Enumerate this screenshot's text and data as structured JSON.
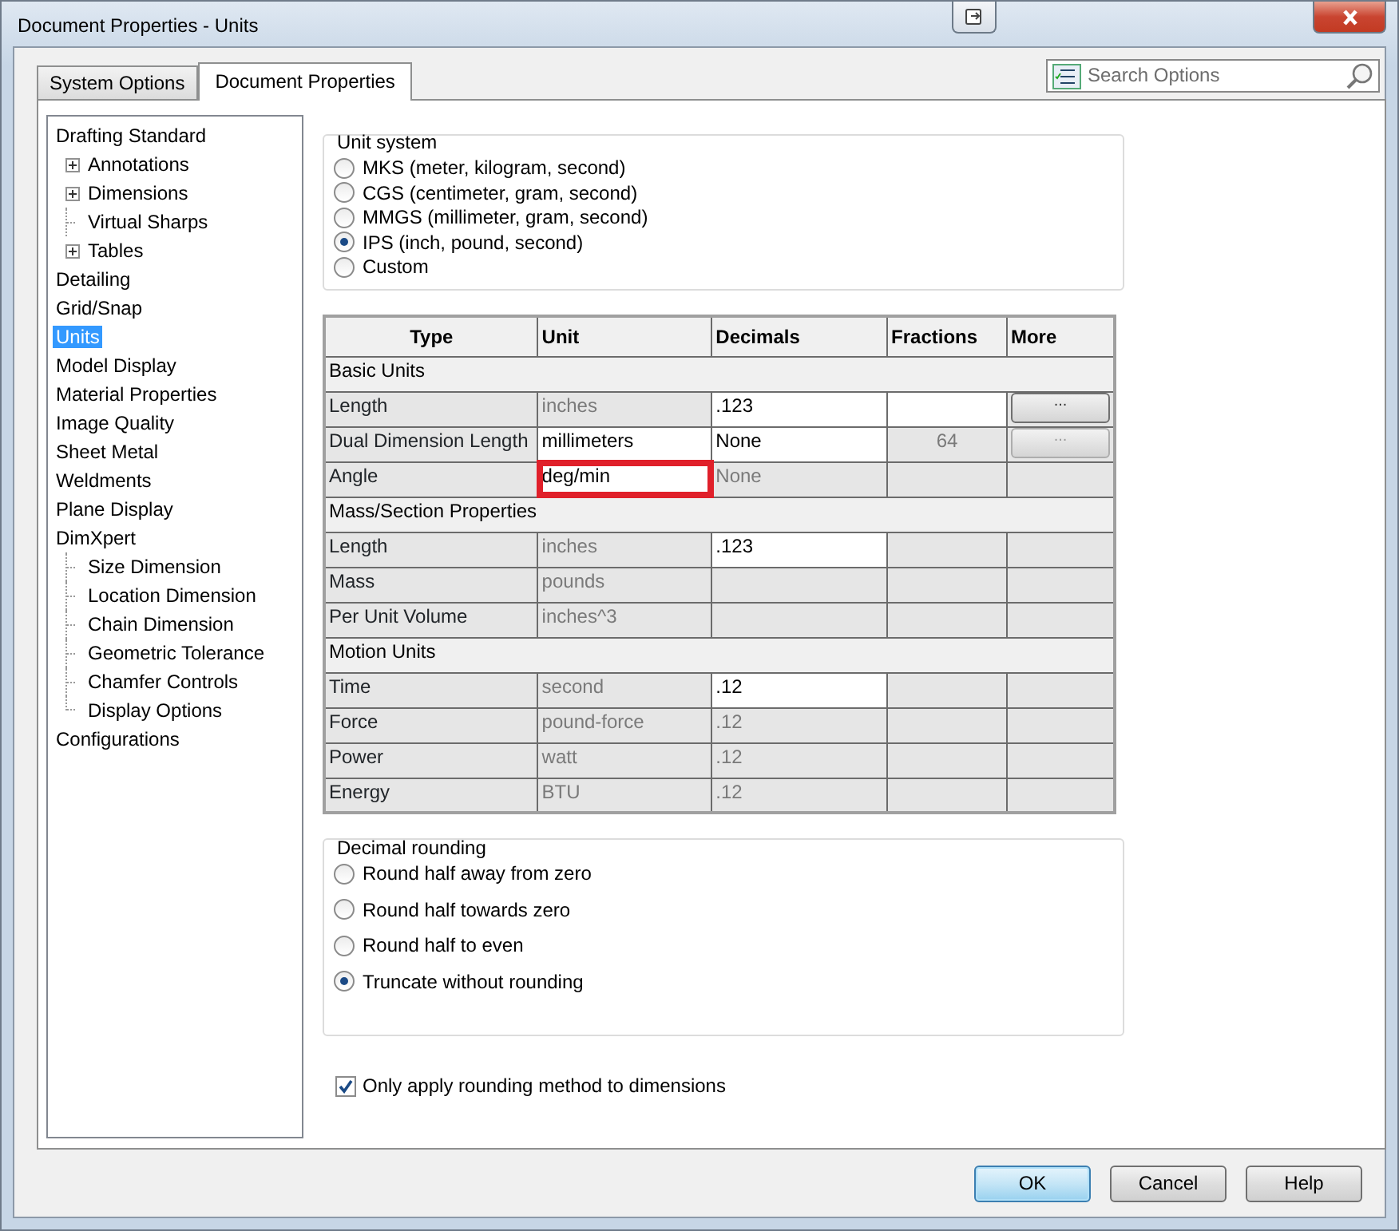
{
  "window": {
    "title": "Document Properties - Units"
  },
  "tabs": [
    {
      "label": "System Options",
      "selected": false
    },
    {
      "label": "Document Properties",
      "selected": true
    }
  ],
  "search": {
    "placeholder": "Search Options"
  },
  "tree": [
    {
      "label": "Drafting Standard",
      "selected": false,
      "children": [
        {
          "label": "Annotations",
          "selected": false,
          "expanded": false
        },
        {
          "label": "Dimensions",
          "selected": false,
          "expanded": false
        },
        {
          "label": "Virtual Sharps",
          "selected": false
        },
        {
          "label": "Tables",
          "selected": false,
          "expanded": false
        }
      ]
    },
    {
      "label": "Detailing",
      "selected": false
    },
    {
      "label": "Grid/Snap",
      "selected": false
    },
    {
      "label": "Units",
      "selected": true
    },
    {
      "label": "Model Display",
      "selected": false
    },
    {
      "label": "Material Properties",
      "selected": false
    },
    {
      "label": "Image Quality",
      "selected": false
    },
    {
      "label": "Sheet Metal",
      "selected": false
    },
    {
      "label": "Weldments",
      "selected": false
    },
    {
      "label": "Plane Display",
      "selected": false
    },
    {
      "label": "DimXpert",
      "selected": false,
      "children": [
        {
          "label": "Size Dimension",
          "selected": false
        },
        {
          "label": "Location Dimension",
          "selected": false
        },
        {
          "label": "Chain Dimension",
          "selected": false
        },
        {
          "label": "Geometric Tolerance",
          "selected": false
        },
        {
          "label": "Chamfer Controls",
          "selected": false
        },
        {
          "label": "Display Options",
          "selected": false
        }
      ]
    },
    {
      "label": "Configurations",
      "selected": false
    }
  ],
  "unit_system": {
    "title": "Unit system",
    "options": [
      {
        "label": "MKS  (meter, kilogram, second)",
        "selected": false
      },
      {
        "label": "CGS  (centimeter, gram, second)",
        "selected": false
      },
      {
        "label": "MMGS  (millimeter, gram, second)",
        "selected": false
      },
      {
        "label": "IPS  (inch, pound, second)",
        "selected": true
      },
      {
        "label": "Custom",
        "selected": false
      }
    ]
  },
  "table": {
    "columns": [
      "Type",
      "Unit",
      "Decimals",
      "Fractions",
      "More"
    ],
    "rows": [
      {
        "kind": "section",
        "label": "Basic Units"
      },
      {
        "kind": "row",
        "type": "Length",
        "unit": {
          "text": "inches",
          "editable": false
        },
        "decimals": {
          "text": ".123",
          "editable": true
        },
        "fractions": {
          "editable": true
        },
        "more": {
          "label": "...",
          "disabled": false
        }
      },
      {
        "kind": "row",
        "type": "Dual Dimension Length",
        "unit": {
          "text": "millimeters",
          "editable": true
        },
        "decimals": {
          "text": "None",
          "editable": true
        },
        "fractions": {
          "text": "64",
          "editable": false
        },
        "more": {
          "label": "...",
          "disabled": true
        }
      },
      {
        "kind": "row",
        "type": "Angle",
        "unit": {
          "text": "deg/min",
          "editable": true,
          "highlighted": true
        },
        "decimals": {
          "text": "None",
          "editable": false
        },
        "fractions": {
          "editable": false
        }
      },
      {
        "kind": "section",
        "label": "Mass/Section Properties"
      },
      {
        "kind": "row",
        "type": "Length",
        "unit": {
          "text": "inches",
          "editable": false
        },
        "decimals": {
          "text": ".123",
          "editable": true
        },
        "fractions": {
          "editable": false
        }
      },
      {
        "kind": "row",
        "type": "Mass",
        "unit": {
          "text": "pounds",
          "editable": false
        },
        "decimals": {
          "editable": false
        },
        "fractions": {
          "editable": false
        }
      },
      {
        "kind": "row",
        "type": "Per Unit Volume",
        "unit": {
          "text": "inches^3",
          "editable": false
        },
        "decimals": {
          "editable": false
        },
        "fractions": {
          "editable": false
        }
      },
      {
        "kind": "section",
        "label": "Motion Units"
      },
      {
        "kind": "row",
        "type": "Time",
        "unit": {
          "text": "second",
          "editable": false
        },
        "decimals": {
          "text": ".12",
          "editable": true
        },
        "fractions": {
          "editable": false
        }
      },
      {
        "kind": "row",
        "type": "Force",
        "unit": {
          "text": "pound-force",
          "editable": false
        },
        "decimals": {
          "text": ".12",
          "editable": false
        },
        "fractions": {
          "editable": false
        }
      },
      {
        "kind": "row",
        "type": "Power",
        "unit": {
          "text": "watt",
          "editable": false
        },
        "decimals": {
          "text": ".12",
          "editable": false
        },
        "fractions": {
          "editable": false
        }
      },
      {
        "kind": "row",
        "type": "Energy",
        "unit": {
          "text": "BTU",
          "editable": false
        },
        "decimals": {
          "text": ".12",
          "editable": false
        },
        "fractions": {
          "editable": false
        }
      }
    ]
  },
  "decimal_rounding": {
    "title": "Decimal rounding",
    "options": [
      {
        "label": "Round half away from zero",
        "selected": false
      },
      {
        "label": "Round half towards zero",
        "selected": false
      },
      {
        "label": "Round half to even",
        "selected": false
      },
      {
        "label": "Truncate without rounding",
        "selected": true
      }
    ]
  },
  "only_apply": {
    "label": "Only apply rounding method to dimensions",
    "checked": true
  },
  "buttons": [
    {
      "label": "OK",
      "default": true
    },
    {
      "label": "Cancel",
      "default": false
    },
    {
      "label": "Help",
      "default": false
    }
  ]
}
